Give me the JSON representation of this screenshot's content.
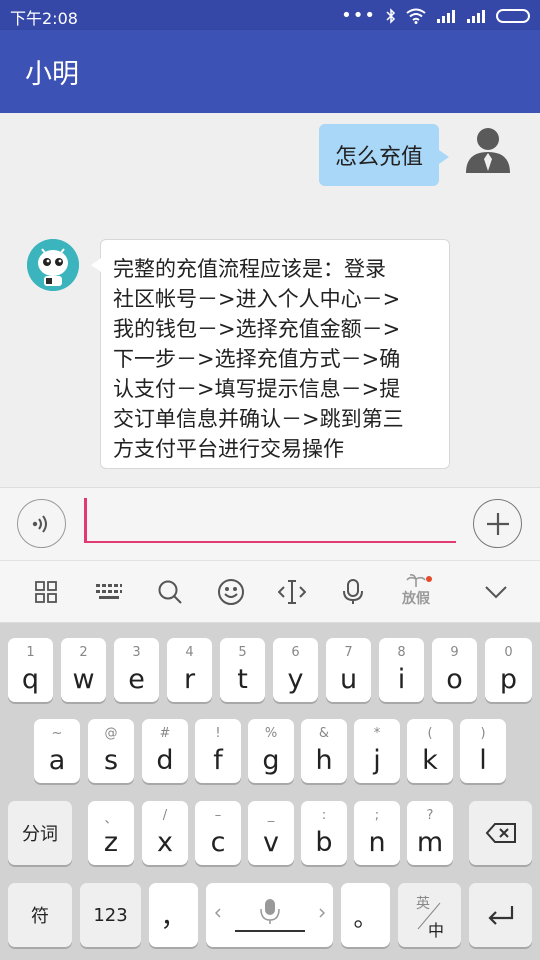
{
  "status_bar": {
    "time": "下午2:08"
  },
  "app_bar": {
    "title": "小明"
  },
  "chat": {
    "outgoing": "怎么充值",
    "incoming_lines": [
      "完整的充值流程应该是：登录",
      "社区帐号－>进入个人中心－>",
      "我的钱包－>选择充值金额－>",
      "下一步－>选择充值方式－>确",
      "认支付－>填写提示信息－>提",
      "交订单信息并确认－>跳到第三",
      "方支付平台进行交易操作"
    ]
  },
  "input": {
    "value": ""
  },
  "ime_toolbar": {
    "holiday_label": "放假"
  },
  "keyboard": {
    "row1": [
      {
        "sub": "1",
        "key": "q"
      },
      {
        "sub": "2",
        "key": "w"
      },
      {
        "sub": "3",
        "key": "e"
      },
      {
        "sub": "4",
        "key": "r"
      },
      {
        "sub": "5",
        "key": "t"
      },
      {
        "sub": "6",
        "key": "y"
      },
      {
        "sub": "7",
        "key": "u"
      },
      {
        "sub": "8",
        "key": "i"
      },
      {
        "sub": "9",
        "key": "o"
      },
      {
        "sub": "0",
        "key": "p"
      }
    ],
    "row2": [
      {
        "sub": "~",
        "key": "a"
      },
      {
        "sub": "@",
        "key": "s"
      },
      {
        "sub": "#",
        "key": "d"
      },
      {
        "sub": "!",
        "key": "f"
      },
      {
        "sub": "%",
        "key": "g"
      },
      {
        "sub": "&",
        "key": "h"
      },
      {
        "sub": "*",
        "key": "j"
      },
      {
        "sub": "(",
        "key": "k"
      },
      {
        "sub": ")",
        "key": "l"
      }
    ],
    "row3": [
      {
        "sub": "、",
        "key": "z"
      },
      {
        "sub": "/",
        "key": "x"
      },
      {
        "sub": "–",
        "key": "c"
      },
      {
        "sub": "_",
        "key": "v"
      },
      {
        "sub": ":",
        "key": "b"
      },
      {
        "sub": ";",
        "key": "n"
      },
      {
        "sub": "?",
        "key": "m"
      }
    ],
    "segment_label": "分词",
    "symbol_label": "符",
    "num_label": "123",
    "comma": "，",
    "period": "。",
    "lang_top": "英",
    "lang_bottom": "中"
  },
  "colors": {
    "status_bar": "#3548a8",
    "app_bar": "#3d52b5",
    "outgoing_bubble": "#a9d7f7",
    "input_accent": "#e03a70"
  }
}
